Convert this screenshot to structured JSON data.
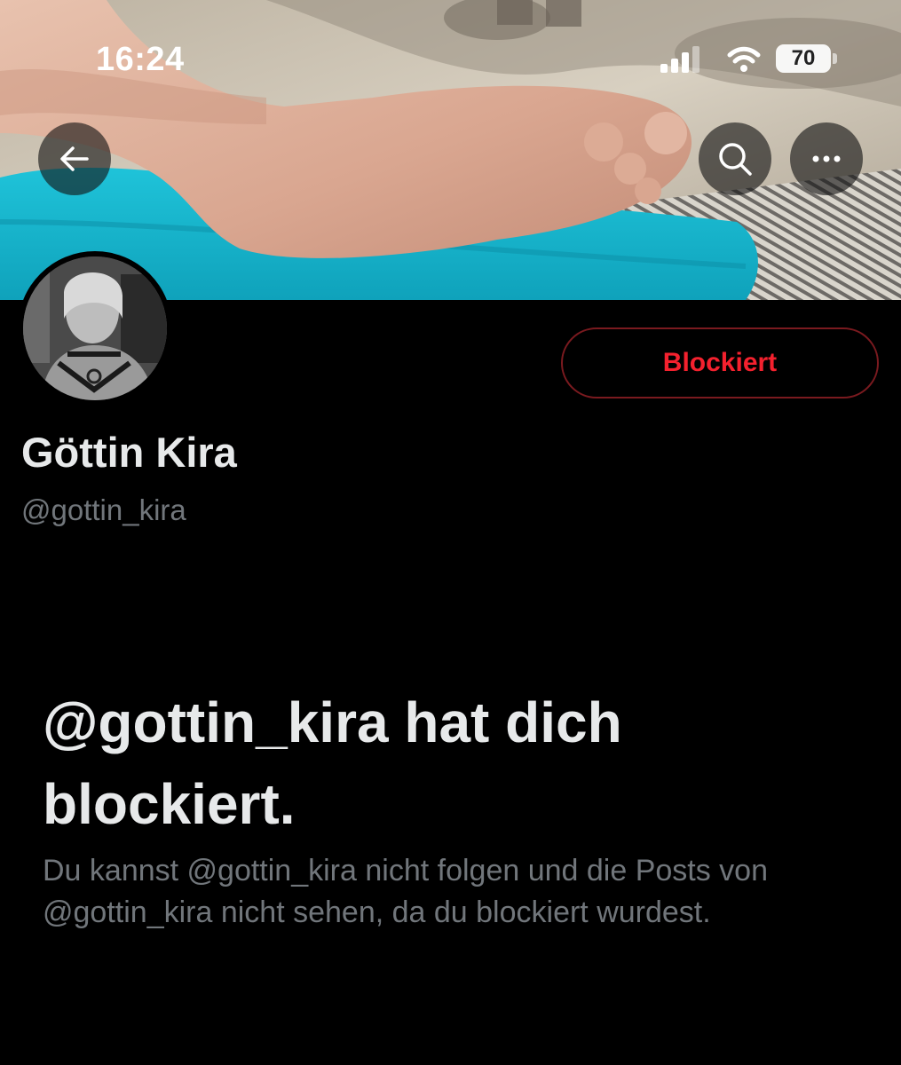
{
  "status_bar": {
    "time": "16:24",
    "battery": "70",
    "icons": [
      "signal-icon",
      "wifi-icon",
      "battery-icon"
    ]
  },
  "nav": {
    "icons": [
      "back-arrow-icon",
      "search-icon",
      "more-icon"
    ]
  },
  "profile": {
    "display_name": "Göttin Kira",
    "handle": "@gottin_kira",
    "blocked_button_label": "Blockiert"
  },
  "blocked_notice": {
    "title": "@gottin_kira hat dich blockiert.",
    "description": "Du kannst @gottin_kira nicht folgen und die Posts von @gottin_kira nicht sehen, da du blockiert wurdest."
  },
  "colors": {
    "background": "#000000",
    "primary_text": "#e7e9ea",
    "secondary_text": "#71767b",
    "blocked_red": "#f4212e",
    "towel": "#1bb7cf"
  }
}
